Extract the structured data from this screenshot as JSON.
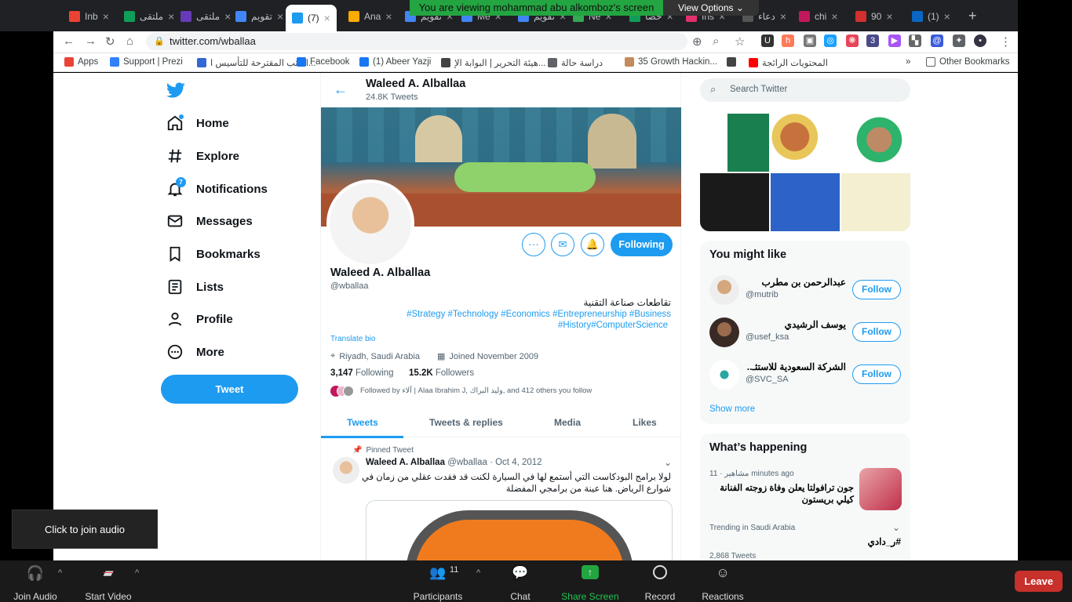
{
  "browser": {
    "tabs": [
      {
        "label": "Inb",
        "color": "#ea4335"
      },
      {
        "label": "ملتقى",
        "color": "#0f9d58"
      },
      {
        "label": "ملتقى",
        "color": "#673ab7"
      },
      {
        "label": "تقويم",
        "color": "#4285f4"
      },
      {
        "label": "(7)",
        "color": "#1d9bf0"
      },
      {
        "label": "Ana",
        "color": "#f9ab00"
      },
      {
        "label": "تقويم",
        "color": "#4285f4"
      },
      {
        "label": "Me",
        "color": "#4285f4"
      },
      {
        "label": "تقويم",
        "color": "#4285f4"
      },
      {
        "label": "Ne",
        "color": "#34a853"
      },
      {
        "label": "حضا",
        "color": "#0f9d58"
      },
      {
        "label": "Ins",
        "color": "#e1306c"
      },
      {
        "label": "دعاء",
        "color": "#555555"
      },
      {
        "label": "chi",
        "color": "#c2185b"
      },
      {
        "label": "90",
        "color": "#d32f2f"
      },
      {
        "label": "(1)",
        "color": "#0a66c2"
      }
    ],
    "url": "twitter.com/wballaa",
    "bookmarks": [
      {
        "label": "Apps",
        "color": "#ea4335"
      },
      {
        "label": "Support | Prezi",
        "color": "#3181ff"
      },
      {
        "label": "الكتب المقترحة للتأسيس ا...",
        "color": "#3367d6"
      },
      {
        "label": "Facebook",
        "color": "#1877f2"
      },
      {
        "label": "(1) Abeer Yazji",
        "color": "#1877f2"
      },
      {
        "label": "هيئة التحرير | البوابة الإ...",
        "color": "#444444"
      },
      {
        "label": "دراسة حالة",
        "color": "#5f6368"
      },
      {
        "label": "35 Growth Hackin...",
        "color": "#c58a5b"
      },
      {
        "label": "",
        "color": "#444444"
      },
      {
        "label": "المحتويات الرائجة",
        "color": "#ff0000"
      }
    ],
    "other_bookmarks": "Other Bookmarks"
  },
  "zoom": {
    "share_banner": "You are viewing mohammad abu alkomboz's screen",
    "view_options": "View Options",
    "audio_tip": "Click to join audio",
    "join_audio": "Join Audio",
    "start_video": "Start Video",
    "participants": "Participants",
    "participants_count": "11",
    "chat": "Chat",
    "share_screen": "Share Screen",
    "record": "Record",
    "reactions": "Reactions",
    "leave": "Leave"
  },
  "twitter": {
    "nav": [
      {
        "label": "Home",
        "icon": "home-icon"
      },
      {
        "label": "Explore",
        "icon": "hashtag-icon"
      },
      {
        "label": "Notifications",
        "icon": "bell-icon",
        "badge": "7"
      },
      {
        "label": "Messages",
        "icon": "mail-icon"
      },
      {
        "label": "Bookmarks",
        "icon": "bookmark-icon"
      },
      {
        "label": "Lists",
        "icon": "list-icon"
      },
      {
        "label": "Profile",
        "icon": "person-icon"
      },
      {
        "label": "More",
        "icon": "more-icon"
      }
    ],
    "tweet_button": "Tweet",
    "header": {
      "name": "Waleed A. Alballaa",
      "count": "24.8K Tweets"
    },
    "profile": {
      "name": "Waleed A. Alballaa",
      "handle": "@wballaa",
      "bio_line1": "تقاطعات صناعة التقنية",
      "bio_tags1": "#Strategy #Technology #Economics #Entrepreneurship #Business",
      "bio_tags2": "#History#ComputerScience",
      "translate": "Translate bio",
      "location": "Riyadh, Saudi Arabia",
      "joined": "Joined November 2009",
      "following_count": "3,147",
      "following_label": "Following",
      "followers_count": "15.2K",
      "followers_label": "Followers",
      "followed_by": "Followed by آلاء | Alaa Ibrahim J, وليد البراك, and 412 others you follow",
      "following_button": "Following"
    },
    "tabs": [
      "Tweets",
      "Tweets & replies",
      "Media",
      "Likes"
    ],
    "pinned": {
      "label": "Pinned Tweet",
      "name": "Waleed A. Alballaa",
      "handle": "@wballaa",
      "date": "Oct 4, 2012",
      "text1": "لولا برامج البودكاست التي أستمع لها في السيارة لكنت قد فقدت عقلي من زمان في",
      "text2": "شوارع الرياض. هنا عينة من برامجي المفضلة"
    },
    "search_placeholder": "Search Twitter",
    "you_might_like": {
      "title": "You might like",
      "users": [
        {
          "name": "عبدالرحمن بن مطرب",
          "handle": "@mutrib",
          "button": "Follow"
        },
        {
          "name": "يوسف الرشيدي",
          "handle": "@usef_ksa",
          "button": "Follow"
        },
        {
          "name": "الشركة السعودية للاستثـ..",
          "handle": "@SVC_SA",
          "button": "Follow"
        }
      ],
      "show_more": "Show more"
    },
    "whats_happening": {
      "title": "What’s happening",
      "item1_meta": "مشاهير · 11 minutes ago",
      "item1_text1": "جون ترافولتا يعلن وفاة زوجته الفنانة",
      "item1_text2": "كيلي بريستون",
      "item2_meta": "Trending in Saudi Arabia",
      "item2_tag": "#ر_دادي",
      "item2_count": "2,868 Tweets"
    }
  }
}
